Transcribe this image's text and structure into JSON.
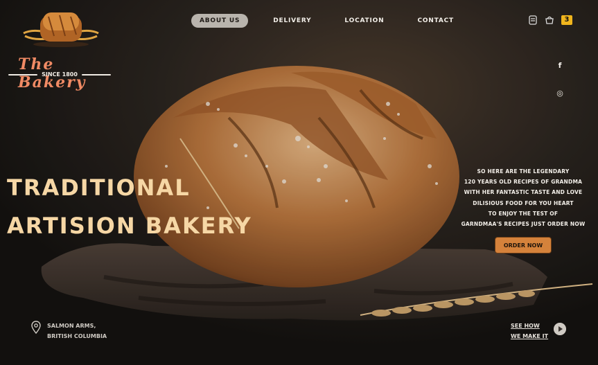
{
  "brand": {
    "title": "The Bakery",
    "since": "SINCE 1800"
  },
  "nav": {
    "items": [
      "ABOUT US",
      "DELIVERY",
      "LOCATION",
      "CONTACT"
    ],
    "active_index": 0
  },
  "header": {
    "cart_count": "3",
    "icons": [
      "receipt-icon",
      "basket-icon"
    ]
  },
  "social": {
    "icons": [
      "facebook-icon",
      "instagram-icon"
    ],
    "facebook_glyph": "f",
    "instagram_glyph": "◎"
  },
  "hero": {
    "headline_line1": "TRADITIONAL",
    "headline_line2": "ARTISION BAKERY",
    "description_lines": [
      "SO HERE ARE THE LEGENDARY",
      "120 YEARS OLD RECIPES OF GRANDMA",
      "WITH HER FANTASTIC TASTE AND LOVE",
      "DILISIOUS FOOD FOR YOU HEART",
      "TO ENJOY THE TEST OF",
      "GARNDMAA'S RECIPES JUST ORDER NOW"
    ],
    "order_button": "ORDER NOW"
  },
  "location": {
    "line1": "SALMON ARMS,",
    "line2": "BRITISH COLUMBIA"
  },
  "video": {
    "line1": "SEE HOW",
    "line2": "WE MAKE IT"
  },
  "colors": {
    "accent": "#d5823b",
    "headline": "#f6d7a5",
    "badge": "#f0b51d",
    "brand": "#f08a64"
  }
}
